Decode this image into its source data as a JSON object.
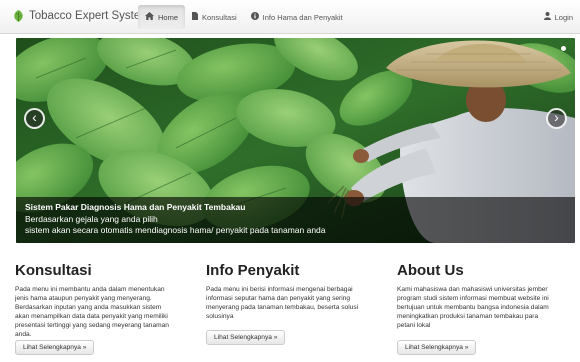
{
  "navbar": {
    "brand": "Tobacco Expert System",
    "items": [
      {
        "label": "Home",
        "icon": "home-icon",
        "active": true
      },
      {
        "label": "Konsultasi",
        "icon": "file-icon",
        "active": false
      },
      {
        "label": "Info Hama dan Penyakit",
        "icon": "info-icon",
        "active": false
      }
    ],
    "login_label": "Login",
    "login_icon": "user-icon"
  },
  "carousel": {
    "caption_title": "Sistem Pakar Diagnosis Hama dan Penyakit Tembakau",
    "caption_line1": "Berdasarkan gejala yang anda pilih",
    "caption_line2": "sistem akan secara otomatis mendiagnosis hama/ penyakit pada tanaman anda",
    "prev_symbol": "‹",
    "next_symbol": "›"
  },
  "columns": [
    {
      "title": "Konsultasi",
      "text": "Pada menu ini membantu anda dalam menentukan jenis hama ataupun penyakit yang menyerang. Berdasarkan inputan yang anda masukkan sistem akan menampilkan data data penyakit yang memiliki presentasi tertinggi yang sedang meyerang tanaman anda.",
      "button": "Lihat Selengkapnya »"
    },
    {
      "title": "Info Penyakit",
      "text": "Pada menu ini berisi informasi mengenai berbagai informasi seputar hama dan penyakit yang sering menyerang pada tanaman tembakau, beserta solusi solusinya",
      "button": "Lihat Selengkapnya »"
    },
    {
      "title": "About Us",
      "text": "Kami mahasiswa dan mahasiswi universitas jember program studi sistem informasi membuat website ini bertujuan untuk membantu bangsa indonesia dalam meningkatkan produksi tanaman tembakau para petani lokal",
      "button": "Lihat Selengkapnya »"
    }
  ],
  "colors": {
    "brand_green": "#6db33f",
    "caption_bg": "#000000"
  }
}
